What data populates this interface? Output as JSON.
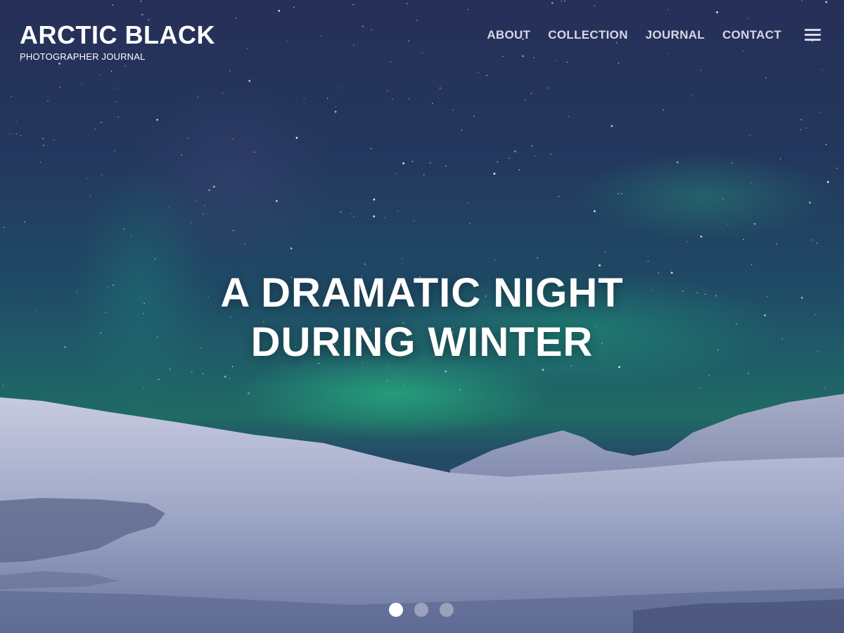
{
  "site": {
    "title": "ARCTIC BLACK",
    "tagline": "PHOTOGRAPHER JOURNAL"
  },
  "nav": {
    "items": [
      {
        "label": "ABOUT"
      },
      {
        "label": "COLLECTION"
      },
      {
        "label": "JOURNAL"
      },
      {
        "label": "CONTACT"
      }
    ],
    "menu_icon": "hamburger-icon"
  },
  "slide": {
    "headline_line1": "A DRAMATIC NIGHT",
    "headline_line2": "DURING WINTER",
    "background": "aurora borealis over snowy hills at night"
  },
  "slider": {
    "slide_count": 3,
    "active_slide": 1
  },
  "colors": {
    "title_text": "#ffffff",
    "nav_text": "#d4d9e4",
    "sky_top": "#262f58",
    "aurora": "#28af82",
    "snow": "#c9cde0"
  }
}
